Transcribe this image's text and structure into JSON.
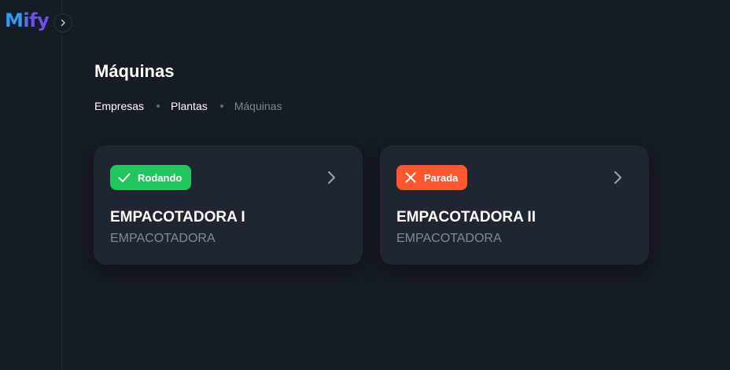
{
  "app": {
    "logo_text": "Mify",
    "brand_colors": [
      "#2f9cf2",
      "#5a6cf0",
      "#6e4fe8"
    ]
  },
  "page": {
    "title": "Máquinas"
  },
  "breadcrumb": [
    {
      "label": "Empresas"
    },
    {
      "label": "Plantas"
    },
    {
      "label": "Máquinas"
    }
  ],
  "machines": [
    {
      "status_label": "Rodando",
      "status_icon": "check-icon",
      "status_color": "#22c55e",
      "name": "EMPACOTADORA I",
      "type": "EMPACOTADORA"
    },
    {
      "status_label": "Parada",
      "status_icon": "x-icon",
      "status_color": "#ff5630",
      "name": "EMPACOTADORA II",
      "type": "EMPACOTADORA"
    }
  ],
  "colors": {
    "background": "#161c24",
    "card": "#1f2630",
    "muted_text": "#7f8b98"
  }
}
